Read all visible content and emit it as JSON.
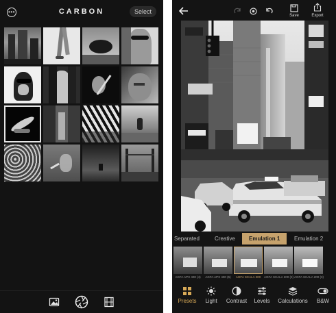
{
  "left_screen": {
    "title": "CARBON",
    "select_label": "Select",
    "menu_icon": "ellipsis-circle-icon",
    "bottom_tabs": [
      "photo-library-icon",
      "camera-aperture-icon",
      "film-strip-icon"
    ]
  },
  "right_screen": {
    "toolbar": {
      "save_label": "Save",
      "export_label": "Export"
    },
    "preset_tabs": [
      "Separated",
      "Creative",
      "Emulation 1",
      "Emulation 2"
    ],
    "active_preset_tab": "Emulation 1",
    "films": [
      "AGFA APX 400 (4)",
      "AGFA APX 400 (5)",
      "AGFA SCALA 200",
      "AGFA SCALA 200 (2)",
      "AGFA SCALA 200 (3)"
    ],
    "active_film": "AGFA SCALA 200",
    "tools": [
      "Presets",
      "Light",
      "Contrast",
      "Levels",
      "Calculations",
      "B&W"
    ],
    "active_tool": "Presets",
    "accent_color": "#c6a26c",
    "tool_accent_color": "#d7a957"
  }
}
